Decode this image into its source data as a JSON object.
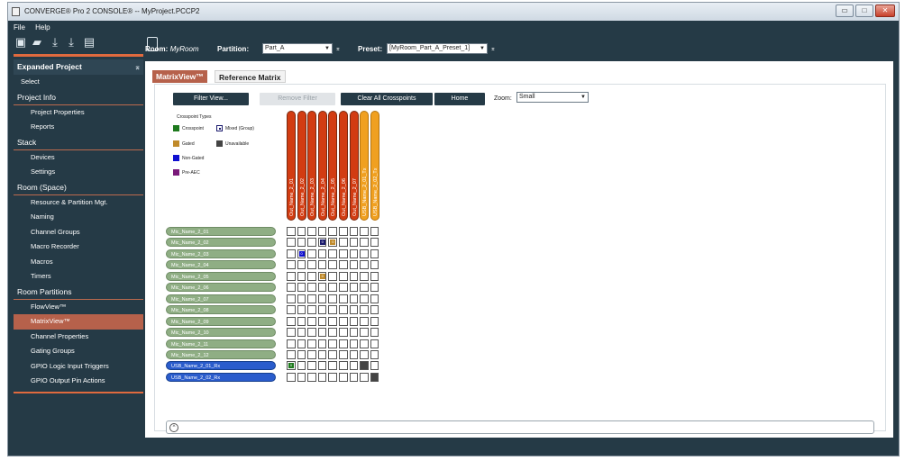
{
  "window": {
    "title": "CONVERGE® Pro 2 CONSOLE® -- MyProject.PCCP2",
    "buttons": [
      "▭",
      "□",
      "✕"
    ]
  },
  "menu": [
    "File",
    "Help"
  ],
  "sidebar": {
    "header": "Expanded Project",
    "pin": "⌅",
    "select": "Select",
    "sections": [
      {
        "title": "Project Info",
        "items": [
          "Project Properties",
          "Reports"
        ]
      },
      {
        "title": "Stack",
        "items": [
          "Devices",
          "Settings"
        ]
      },
      {
        "title": "Room (Space)",
        "items": [
          "Resource & Partition Mgt.",
          "Naming",
          "Channel Groups",
          "Macro Recorder",
          "Macros",
          "Timers"
        ]
      },
      {
        "title": "Room Partitions",
        "items": [
          "FlowView™",
          "MatrixView™",
          "Channel Properties",
          "Gating Groups",
          "GPIO Logic Input Triggers",
          "GPIO Output Pin Actions"
        ]
      }
    ],
    "selected_item": "MatrixView™"
  },
  "topbar": {
    "room_label": "Room:",
    "room_value": "MyRoom",
    "partition_label": "Partition:",
    "partition_value": "Part_A",
    "preset_label": "Preset:",
    "preset_value": "[MyRoom_Part_A_Preset_1]"
  },
  "tabs": [
    {
      "label": "MatrixView™",
      "active": true
    },
    {
      "label": "Reference Matrix",
      "active": false
    }
  ],
  "buttons": {
    "filter_view": "Filter View...",
    "remove_filter": "Remove Filter",
    "clear_all": "Clear All Crosspoints",
    "home": "Home"
  },
  "zoom": {
    "label": "Zoom:",
    "value": "Small"
  },
  "legend": {
    "title": "Crosspoint Types",
    "items": [
      {
        "label": "Crosspoint",
        "color": "#1e7a1e"
      },
      {
        "label": "Mixed (Group)",
        "color": "#1a1a6e"
      },
      {
        "label": "Gated",
        "color": "#c08a2a"
      },
      {
        "label": "Unavailable",
        "color": "#444444"
      },
      {
        "label": "Non-Gated",
        "color": "#1010d0"
      },
      {
        "label": "Pre-AEC",
        "color": "#7a1a7a"
      }
    ]
  },
  "outputs": [
    {
      "name": "Out_Name_2_01",
      "color": "#d23c12"
    },
    {
      "name": "Out_Name_2_02",
      "color": "#d23c12"
    },
    {
      "name": "Out_Name_2_03",
      "color": "#d23c12"
    },
    {
      "name": "Out_Name_2_04",
      "color": "#d23c12"
    },
    {
      "name": "Out_Name_2_05",
      "color": "#d23c12"
    },
    {
      "name": "Out_Name_2_06",
      "color": "#d23c12"
    },
    {
      "name": "Out_Name_2_07",
      "color": "#d23c12"
    },
    {
      "name": "USB_Name_2_01_Tx",
      "color": "#f0a020"
    },
    {
      "name": "USB_Name_2_02_Tx",
      "color": "#f0a020"
    }
  ],
  "inputs": [
    {
      "name": "Mic_Name_2_01",
      "color": "#8fae84"
    },
    {
      "name": "Mic_Name_2_02",
      "color": "#8fae84"
    },
    {
      "name": "Mic_Name_2_03",
      "color": "#8fae84"
    },
    {
      "name": "Mic_Name_2_04",
      "color": "#8fae84"
    },
    {
      "name": "Mic_Name_2_05",
      "color": "#8fae84"
    },
    {
      "name": "Mic_Name_2_06",
      "color": "#8fae84"
    },
    {
      "name": "Mic_Name_2_07",
      "color": "#8fae84"
    },
    {
      "name": "Mic_Name_2_08",
      "color": "#8fae84"
    },
    {
      "name": "Mic_Name_2_09",
      "color": "#8fae84"
    },
    {
      "name": "Mic_Name_2_10",
      "color": "#8fae84"
    },
    {
      "name": "Mic_Name_2_11",
      "color": "#8fae84"
    },
    {
      "name": "Mic_Name_2_12",
      "color": "#8fae84"
    },
    {
      "name": "USB_Name_2_01_Rx",
      "color": "#2a5ccc"
    },
    {
      "name": "USB_Name_2_02_Rx",
      "color": "#2a5ccc"
    }
  ],
  "crosspoints": [
    {
      "row": 1,
      "col": 3,
      "type": "Mixed (Group)",
      "text": "0"
    },
    {
      "row": 1,
      "col": 4,
      "type": "Gated",
      "text": "0"
    },
    {
      "row": 2,
      "col": 1,
      "type": "Non-Gated",
      "text": "0"
    },
    {
      "row": 4,
      "col": 3,
      "type": "Gated",
      "text": "0"
    },
    {
      "row": 12,
      "col": 0,
      "type": "Crosspoint",
      "text": "0"
    },
    {
      "row": 12,
      "col": 7,
      "type": "Unavailable",
      "text": ""
    },
    {
      "row": 13,
      "col": 8,
      "type": "Unavailable",
      "text": ""
    }
  ],
  "bottom_bar": {
    "expand_icon": "^"
  }
}
